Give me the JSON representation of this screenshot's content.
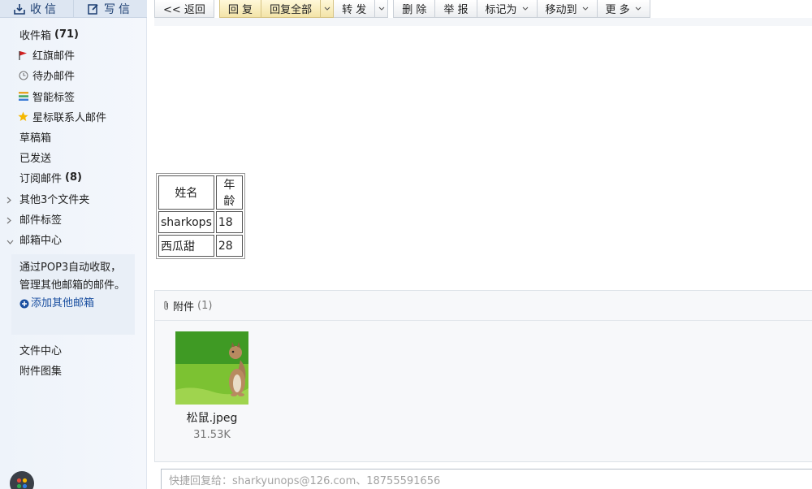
{
  "sidebar": {
    "receive": "收信",
    "compose": "写信",
    "items": [
      {
        "label": "收件箱",
        "count": "(71)"
      },
      {
        "label": "红旗邮件"
      },
      {
        "label": "待办邮件"
      },
      {
        "label": "智能标签"
      },
      {
        "label": "星标联系人邮件"
      },
      {
        "label": "草稿箱"
      },
      {
        "label": "已发送"
      },
      {
        "label": "订阅邮件",
        "count": "(8)"
      },
      {
        "label": "其他3个文件夹"
      },
      {
        "label": "邮件标签"
      },
      {
        "label": "邮箱中心"
      }
    ],
    "pop3_text": "通过POP3自动收取，管理其他邮箱的邮件。",
    "pop3_link": "添加其他邮箱",
    "items2": [
      {
        "label": "文件中心"
      },
      {
        "label": "附件图集"
      }
    ]
  },
  "toolbar": {
    "back": "<< 返回",
    "reply": "回 复",
    "reply_all": "回复全部",
    "forward": "转 发",
    "delete": "删 除",
    "report": "举 报",
    "mark_as": "标记为",
    "move_to": "移动到",
    "more": "更 多"
  },
  "table": {
    "headers": [
      "姓名",
      "年龄"
    ],
    "rows": [
      [
        "sharkops",
        "18"
      ],
      [
        "西瓜甜",
        "28"
      ]
    ]
  },
  "attachments": {
    "title": "附件",
    "count": "(1)",
    "files": [
      {
        "name": "松鼠.jpeg",
        "size": "31.53K"
      }
    ]
  },
  "quick_reply": {
    "placeholder": "快捷回复给：sharkyunops@126.com、18755591656"
  },
  "colors": {
    "flag": "#d11f1f",
    "star": "#f5b800",
    "link": "#1a4fa0"
  }
}
